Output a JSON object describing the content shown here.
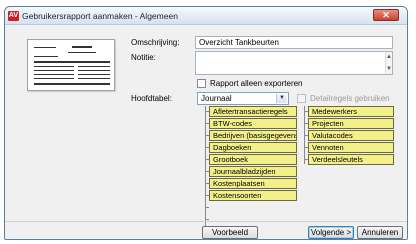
{
  "window": {
    "app_icon_text": "AV",
    "title": "Gebruikersrapport aanmaken - Algemeen",
    "close_symbol": "✕"
  },
  "form": {
    "description_label": "Omschrijving:",
    "description_value": "Overzicht Tankbeurten",
    "note_label": "Notitie:",
    "note_value": "",
    "export_only_label": "Rapport alleen exporteren",
    "export_only_checked": false,
    "detail_rules_label": "Detailregels gebruiken",
    "detail_rules_checked": false,
    "main_table_label": "Hoofdtabel:",
    "main_table_value": "Journaal"
  },
  "tables": {
    "column1": [
      "Afletertransactieregels",
      "BTW-codes",
      "Bedrijven (basisgegevens)",
      "Dagboeken",
      "Grootboek",
      "Journaalbladzijden",
      "Kostenplaatsen",
      "Kostensoorten"
    ],
    "column2": [
      "Medewerkers",
      "Projecten",
      "Valutacodes",
      "Vennoten",
      "Verdeelsleutels"
    ]
  },
  "buttons": {
    "preview": "Voorbeeld",
    "next": "Volgende >",
    "cancel": "Annuleren"
  }
}
